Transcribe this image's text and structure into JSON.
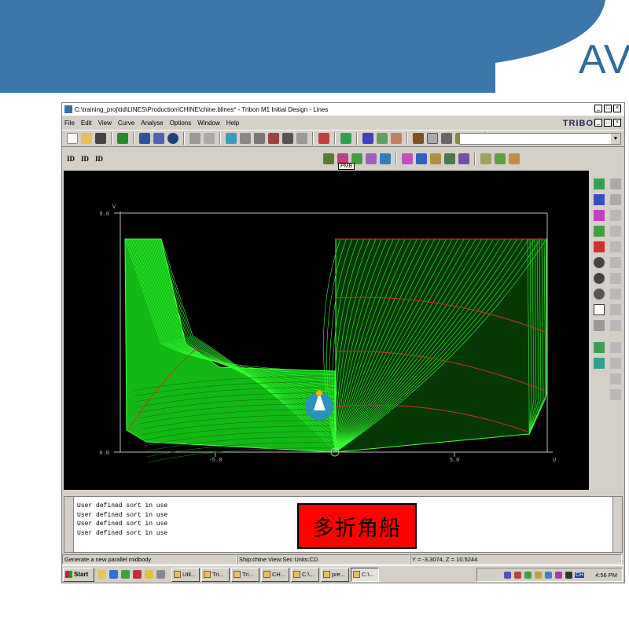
{
  "slide": {
    "logo_text": "AV"
  },
  "window": {
    "title": "C:\\training_proj\\tid\\LINES\\Production\\CHINE\\chine.blines* - Tribon M1 Initial Design - Lines",
    "brand": "TRIBON",
    "controls": [
      "_",
      "□",
      "×"
    ],
    "inner_controls": [
      "_",
      "□",
      "×"
    ]
  },
  "menu": [
    "File",
    "Edit",
    "View",
    "Curve",
    "Analyse",
    "Options",
    "Window",
    "Help"
  ],
  "toolbar2": {
    "id_labels": [
      "ID",
      "ID",
      "ID"
    ],
    "tooltip": "PMB"
  },
  "plot": {
    "v_axis_label": "V",
    "u_axis_label": "U",
    "v_max_label": "9.0",
    "v_min_label": "0.0",
    "u_left_label": "-5.0",
    "u_right_label": "5.0",
    "colors": {
      "background": "#000000",
      "mesh": "#33ff33",
      "fill": "#11c811",
      "curves": "#ff2a2a",
      "frame": "#bbbbbb"
    }
  },
  "console": {
    "lines": [
      "User defined sort in use",
      "User defined sort in use",
      "User defined sort in use",
      "User defined sort in use"
    ],
    "overlay_text": "多折角船"
  },
  "status": {
    "message": "Generate a new  parallel midbody",
    "ship": "Ship:chine  View:Sec  Units:CD",
    "y": "Y =    -3.3074,  Z =    10.5244"
  },
  "taskbar": {
    "start": "Start",
    "tasks": [
      "Util...",
      "Tri...",
      "Tri...",
      "CH...",
      "C:\\...",
      "pre...",
      "C:\\..."
    ],
    "clock": "4:56 PM",
    "lang": "CH"
  }
}
